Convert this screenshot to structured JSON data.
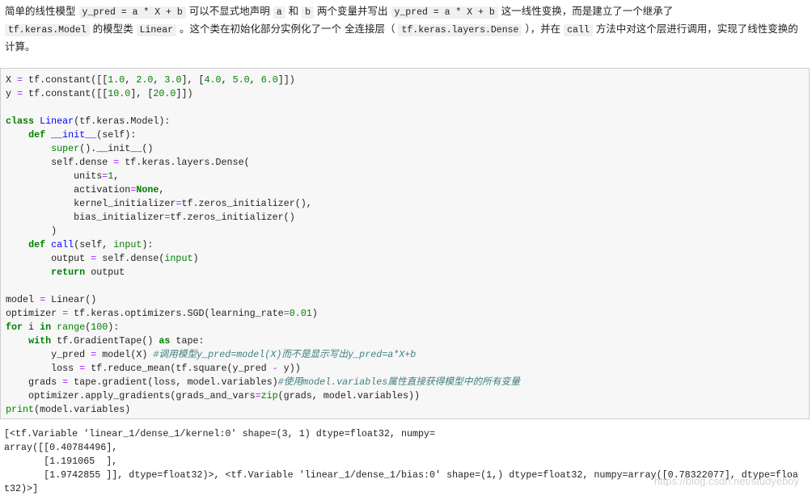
{
  "intro": {
    "p1": "简单的线性模型",
    "c1": "y_pred = a * X + b",
    "p2": "可以不显式地声明",
    "c2": "a",
    "p3": "和",
    "c3": "b",
    "p4": "两个变量并写出",
    "c4": "y_pred = a * X + b",
    "p5": "这一线性变换，而是建立了一个继承了",
    "c5": "tf.keras.Model",
    "p6": "的模型类",
    "c6": "Linear",
    "p7": "。这个类在初始化部分实例化了一个 全连接层（",
    "c7": "tf.keras.layers.Dense",
    "p8": "），并在",
    "c8": "call",
    "p9": "方法中对这个层进行调用，实现了线性变换的计算。"
  },
  "code_lines": [
    [
      [
        "",
        "X "
      ],
      [
        "o",
        "="
      ],
      [
        "",
        " tf.constant([["
      ],
      [
        "n",
        "1.0"
      ],
      [
        "",
        ", "
      ],
      [
        "n",
        "2.0"
      ],
      [
        "",
        ", "
      ],
      [
        "n",
        "3.0"
      ],
      [
        "",
        "], ["
      ],
      [
        "n",
        "4.0"
      ],
      [
        "",
        ", "
      ],
      [
        "n",
        "5.0"
      ],
      [
        "",
        ", "
      ],
      [
        "n",
        "6.0"
      ],
      [
        "",
        "]])"
      ]
    ],
    [
      [
        "",
        "y "
      ],
      [
        "o",
        "="
      ],
      [
        "",
        " tf.constant([["
      ],
      [
        "n",
        "10.0"
      ],
      [
        "",
        "], ["
      ],
      [
        "n",
        "20.0"
      ],
      [
        "",
        "]])"
      ]
    ],
    [],
    [
      [
        "k",
        "class"
      ],
      [
        "",
        " "
      ],
      [
        "f",
        "Linear"
      ],
      [
        "",
        "(tf.keras.Model):"
      ]
    ],
    [
      [
        "",
        "    "
      ],
      [
        "k",
        "def"
      ],
      [
        "",
        " "
      ],
      [
        "f",
        "__init__"
      ],
      [
        "",
        "(self):"
      ]
    ],
    [
      [
        "",
        "        "
      ],
      [
        "b",
        "super"
      ],
      [
        "",
        "().__init__()"
      ]
    ],
    [
      [
        "",
        "        self.dense "
      ],
      [
        "o",
        "="
      ],
      [
        "",
        " tf.keras.layers.Dense("
      ]
    ],
    [
      [
        "",
        "            units"
      ],
      [
        "o",
        "="
      ],
      [
        "n",
        "1"
      ],
      [
        "",
        ","
      ]
    ],
    [
      [
        "",
        "            activation"
      ],
      [
        "o",
        "="
      ],
      [
        "k",
        "None"
      ],
      [
        "",
        ","
      ]
    ],
    [
      [
        "",
        "            kernel_initializer"
      ],
      [
        "o",
        "="
      ],
      [
        "",
        "tf.zeros_initializer(),"
      ]
    ],
    [
      [
        "",
        "            bias_initializer"
      ],
      [
        "o",
        "="
      ],
      [
        "",
        "tf.zeros_initializer()"
      ]
    ],
    [
      [
        "",
        "        )"
      ]
    ],
    [
      [
        "",
        "    "
      ],
      [
        "k",
        "def"
      ],
      [
        "",
        " "
      ],
      [
        "f",
        "call"
      ],
      [
        "",
        "(self, "
      ],
      [
        "b",
        "input"
      ],
      [
        "",
        "):"
      ]
    ],
    [
      [
        "",
        "        output "
      ],
      [
        "o",
        "="
      ],
      [
        "",
        " self.dense("
      ],
      [
        "b",
        "input"
      ],
      [
        "",
        ")"
      ]
    ],
    [
      [
        "",
        "        "
      ],
      [
        "k",
        "return"
      ],
      [
        "",
        " output"
      ]
    ],
    [],
    [
      [
        "",
        "model "
      ],
      [
        "o",
        "="
      ],
      [
        "",
        " Linear()"
      ]
    ],
    [
      [
        "",
        "optimizer "
      ],
      [
        "o",
        "="
      ],
      [
        "",
        " tf.keras.optimizers.SGD(learning_rate"
      ],
      [
        "o",
        "="
      ],
      [
        "n",
        "0.01"
      ],
      [
        "",
        ")"
      ]
    ],
    [
      [
        "k",
        "for"
      ],
      [
        "",
        " i "
      ],
      [
        "k",
        "in"
      ],
      [
        "",
        " "
      ],
      [
        "b",
        "range"
      ],
      [
        "",
        "("
      ],
      [
        "n",
        "100"
      ],
      [
        "",
        "):"
      ]
    ],
    [
      [
        "",
        "    "
      ],
      [
        "k",
        "with"
      ],
      [
        "",
        " tf.GradientTape() "
      ],
      [
        "k",
        "as"
      ],
      [
        "",
        " tape:"
      ]
    ],
    [
      [
        "",
        "        y_pred "
      ],
      [
        "o",
        "="
      ],
      [
        "",
        " model(X) "
      ],
      [
        "c",
        "#调用模型y_pred=model(X)而不是显示写出y_pred=a*X+b"
      ]
    ],
    [
      [
        "",
        "        loss "
      ],
      [
        "o",
        "="
      ],
      [
        "",
        " tf.reduce_mean(tf.square(y_pred "
      ],
      [
        "o",
        "-"
      ],
      [
        "",
        " y))"
      ]
    ],
    [
      [
        "",
        "    grads "
      ],
      [
        "o",
        "="
      ],
      [
        "",
        " tape.gradient(loss, model.variables)"
      ],
      [
        "c",
        "#使用model.variables属性直接获得模型中的所有变量"
      ]
    ],
    [
      [
        "",
        "    optimizer.apply_gradients(grads_and_vars"
      ],
      [
        "o",
        "="
      ],
      [
        "b",
        "zip"
      ],
      [
        "",
        "(grads, model.variables))"
      ]
    ],
    [
      [
        "b",
        "print"
      ],
      [
        "",
        "(model.variables)"
      ]
    ]
  ],
  "output_lines": [
    "[<tf.Variable 'linear_1/dense_1/kernel:0' shape=(3, 1) dtype=float32, numpy=",
    "array([[0.40784496],",
    "       [1.191065  ],",
    "       [1.9742855 ]], dtype=float32)>, <tf.Variable 'linear_1/dense_1/bias:0' shape=(1,) dtype=float32, numpy=array([0.78322077], dtype=floa",
    "t32)>]"
  ],
  "watermark": "https://blog.csdn.net/studyeboy"
}
